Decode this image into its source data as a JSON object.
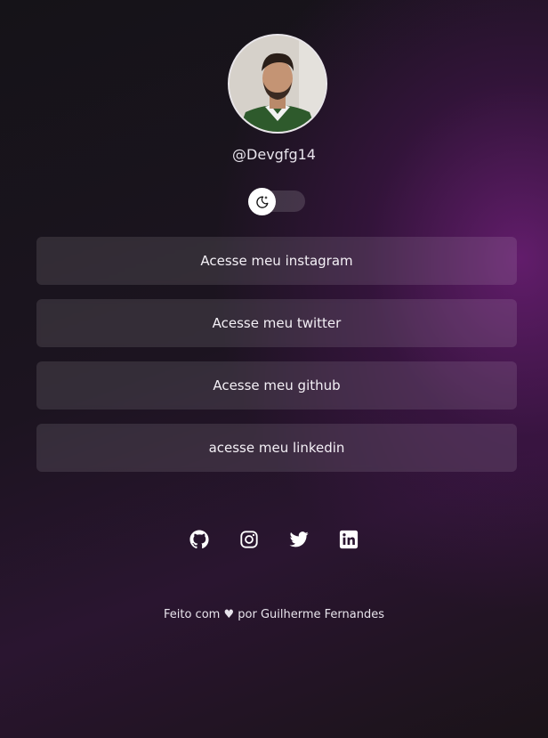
{
  "profile": {
    "username": "@Devgfg14"
  },
  "theme_toggle": {
    "icon": "moon-icon",
    "state": "off"
  },
  "links": [
    {
      "label": "Acesse meu instagram"
    },
    {
      "label": "Acesse meu twitter"
    },
    {
      "label": "Acesse meu github"
    },
    {
      "label": "acesse meu linkedin"
    }
  ],
  "social_icons": [
    "github-icon",
    "instagram-icon",
    "twitter-icon",
    "linkedin-icon"
  ],
  "footer": {
    "text_before": "Feito com",
    "heart": "♥",
    "text_after": "por Guilherme Fernandes"
  },
  "colors": {
    "accent": "#6e1e78",
    "background": "#151318"
  }
}
